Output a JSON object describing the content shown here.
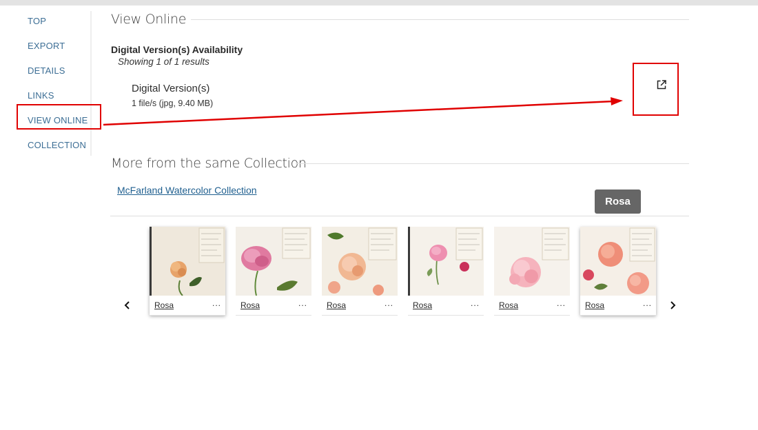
{
  "nav": {
    "items": [
      {
        "label": "TOP"
      },
      {
        "label": "EXPORT"
      },
      {
        "label": "DETAILS"
      },
      {
        "label": "LINKS"
      },
      {
        "label": "VIEW ONLINE"
      },
      {
        "label": "COLLECTION"
      }
    ]
  },
  "view_online": {
    "heading": "View Online",
    "availability_title": "Digital Version(s) Availability",
    "results_text": "Showing 1 of 1 results",
    "item_title": "Digital Version(s)",
    "item_meta": "1 file/s (jpg, 9.40 MB)",
    "external_link_icon": "open-in-new-icon"
  },
  "collection": {
    "heading": "More from the same Collection",
    "link_text": "McFarland Watercolor Collection",
    "tooltip": "Rosa",
    "prev_icon": "chevron-left-icon",
    "next_icon": "chevron-right-icon",
    "cards": [
      {
        "title": "Rosa",
        "more": "..."
      },
      {
        "title": "Rosa",
        "more": "..."
      },
      {
        "title": "Rosa",
        "more": "..."
      },
      {
        "title": "Rosa",
        "more": "..."
      },
      {
        "title": "Rosa",
        "more": "..."
      },
      {
        "title": "Rosa",
        "more": "..."
      }
    ]
  },
  "colors": {
    "nav_link": "#3c6e95",
    "link": "#1f5f8f",
    "annotation": "#e00000",
    "tooltip_bg": "#666666"
  }
}
